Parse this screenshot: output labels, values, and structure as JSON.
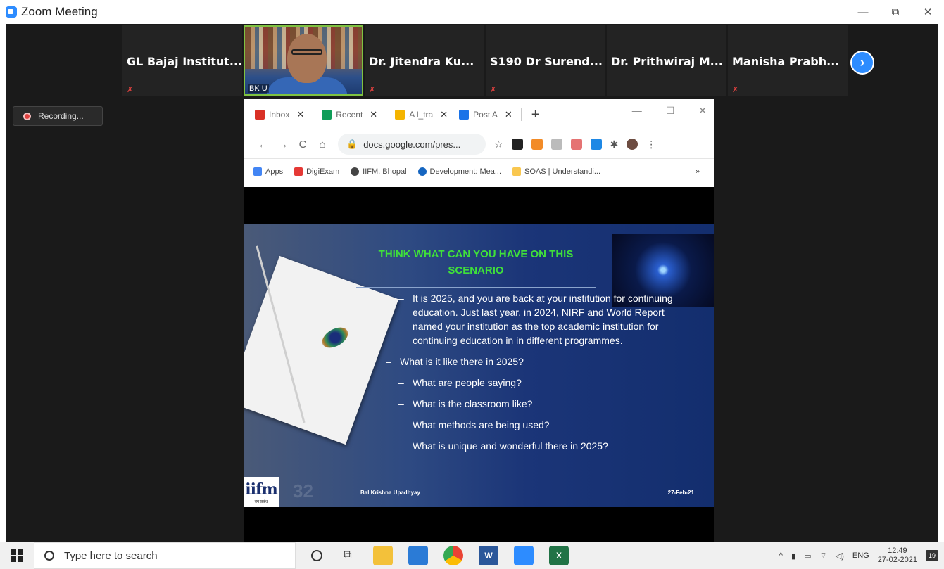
{
  "window": {
    "title": "Zoom Meeting",
    "minimize": "—",
    "restore": "⧉",
    "close": "✕"
  },
  "participants": [
    {
      "name": "GL Bajaj Institut..."
    },
    {
      "name": "BK U"
    },
    {
      "name": "Dr. Jitendra Ku..."
    },
    {
      "name": "S190 Dr Surend..."
    },
    {
      "name": "Dr. Prithwiraj M..."
    },
    {
      "name": "Manisha Prabh..."
    }
  ],
  "next_page": "›",
  "recording": {
    "label": "Recording..."
  },
  "browser": {
    "tabs": [
      {
        "label": "Inbox",
        "color": "#d93025"
      },
      {
        "label": "Recent",
        "color": "#0f9d58"
      },
      {
        "label": "A l_tra",
        "color": "#f4b400"
      },
      {
        "label": "Post A",
        "color": "#1a73e8"
      }
    ],
    "tab_close": "✕",
    "new_tab": "+",
    "minimize": "—",
    "maximize": "☐",
    "close": "✕",
    "back": "←",
    "forward": "→",
    "reload": "C",
    "home": "⌂",
    "url": "docs.google.com/pres...",
    "bookmarks": [
      {
        "label": "Apps",
        "color": "#4285f4"
      },
      {
        "label": "DigiExam",
        "color": "#e53935"
      },
      {
        "label": "IIFM, Bhopal",
        "color": "#444444"
      },
      {
        "label": "Development: Mea...",
        "color": "#1565c0"
      },
      {
        "label": "SOAS | Understandi...",
        "color": "#f9c74f"
      }
    ],
    "more_bookmarks": "»"
  },
  "slide": {
    "title_line1": "THINK WHAT CAN YOU HAVE ON THIS",
    "title_line2": "SCENARIO",
    "bullets": [
      "It is 2025, and you are back at your institution for continuing education. Just last year, in 2024, NIRF and World Report named your institution as the top academic institution for continuing education in in different programmes.",
      "What is  it like there in 2025?",
      "What are people saying?",
      "What is the classroom like?",
      "What methods are being used?",
      "What is unique and wonderful there in 2025?"
    ],
    "dash": "–",
    "slide_number": "32",
    "footer_author": "Bal Krishna Upadhyay",
    "footer_date": "27-Feb-21",
    "logo_text": "iifm",
    "logo_sub": "वन प्रबंध"
  },
  "taskbar": {
    "search_placeholder": "Type here to search",
    "language": "ENG",
    "time": "12:49",
    "date": "27-02-2021",
    "notifications": "19"
  }
}
